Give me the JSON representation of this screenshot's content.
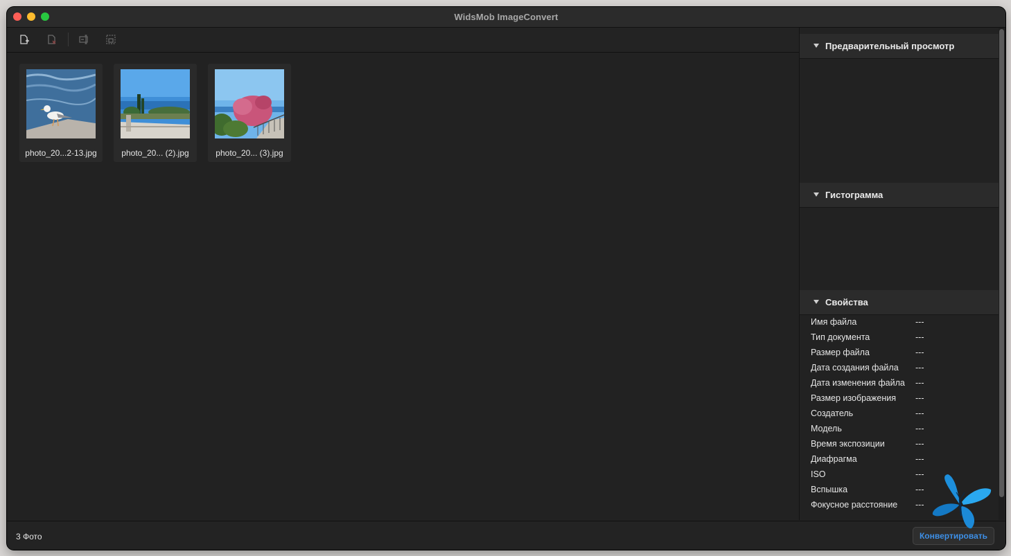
{
  "window": {
    "title": "WidsMob ImageConvert"
  },
  "toolbar": {
    "buttons": [
      {
        "name": "add-files-button",
        "icon": "add-image-icon"
      },
      {
        "name": "remove-files-button",
        "icon": "remove-image-icon"
      },
      {
        "name": "rename-button",
        "icon": "rename-icon"
      },
      {
        "name": "resize-button",
        "icon": "resize-icon"
      }
    ]
  },
  "files": [
    {
      "name": "photo_20...2-13.jpg",
      "subject": "seagull on pier over water"
    },
    {
      "name": "photo_20... (2).jpg",
      "subject": "terrace with cypress trees and sea"
    },
    {
      "name": "photo_20... (3).jpg",
      "subject": "pink flowering tree by railing"
    }
  ],
  "status": {
    "count": "3 Фото"
  },
  "actions": {
    "convert_label": "Конвертировать"
  },
  "panels": {
    "preview": {
      "title": "Предварительный просмотр"
    },
    "histogram": {
      "title": "Гистограмма"
    },
    "properties": {
      "title": "Свойства",
      "rows": [
        {
          "key": "Имя файла",
          "value": "---"
        },
        {
          "key": "Тип документа",
          "value": "---"
        },
        {
          "key": "Размер файла",
          "value": "---"
        },
        {
          "key": "Дата создания файла",
          "value": "---"
        },
        {
          "key": "Дата изменения файла",
          "value": "---"
        },
        {
          "key": "Размер изображения",
          "value": "---"
        },
        {
          "key": "Создатель",
          "value": "---"
        },
        {
          "key": "Модель",
          "value": "---"
        },
        {
          "key": "Время экспозиции",
          "value": "---"
        },
        {
          "key": "Диафрагма",
          "value": "---"
        },
        {
          "key": "ISO",
          "value": "---"
        },
        {
          "key": "Вспышка",
          "value": "---"
        },
        {
          "key": "Фокусное расстояние",
          "value": "---"
        }
      ]
    }
  },
  "colors": {
    "accent": "#3d8fe6",
    "background": "#222222"
  }
}
